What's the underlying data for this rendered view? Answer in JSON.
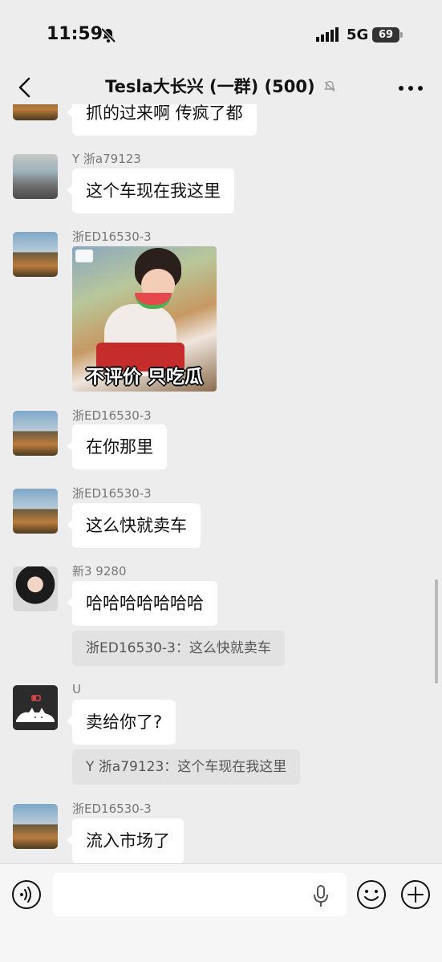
{
  "status_bar": {
    "time": "11:59",
    "network": "5G",
    "battery": "69"
  },
  "header": {
    "title": "Tesla大长兴 (一群) (500)"
  },
  "messages": [
    {
      "text": "抓的过来啊 传疯了都"
    },
    {
      "sender": "Y 浙a79123",
      "text": "这个车现在我这里"
    },
    {
      "sender": "浙ED16530-3",
      "sticker_caption": "不评价 只吃瓜"
    },
    {
      "sender": "浙ED16530-3",
      "text": "在你那里"
    },
    {
      "sender": "浙ED16530-3",
      "text": "这么快就卖车"
    },
    {
      "sender": "新3 9280",
      "text": "哈哈哈哈哈哈哈",
      "quote": "浙ED16530-3：这么快就卖车"
    },
    {
      "sender": "U",
      "text": "卖给你了?",
      "quote": "Y 浙a79123：这个车现在我这里"
    },
    {
      "sender": "浙ED16530-3",
      "text": "流入市场了"
    }
  ],
  "input": {
    "placeholder": ""
  },
  "icons": {
    "status": [
      "bell-off-icon",
      "signal-icon",
      "battery-icon"
    ],
    "header": [
      "back-arrow-icon",
      "muted-bell-icon",
      "more-icon"
    ],
    "input": [
      "voice-icon",
      "mic-icon",
      "emoji-icon",
      "plus-icon"
    ]
  }
}
